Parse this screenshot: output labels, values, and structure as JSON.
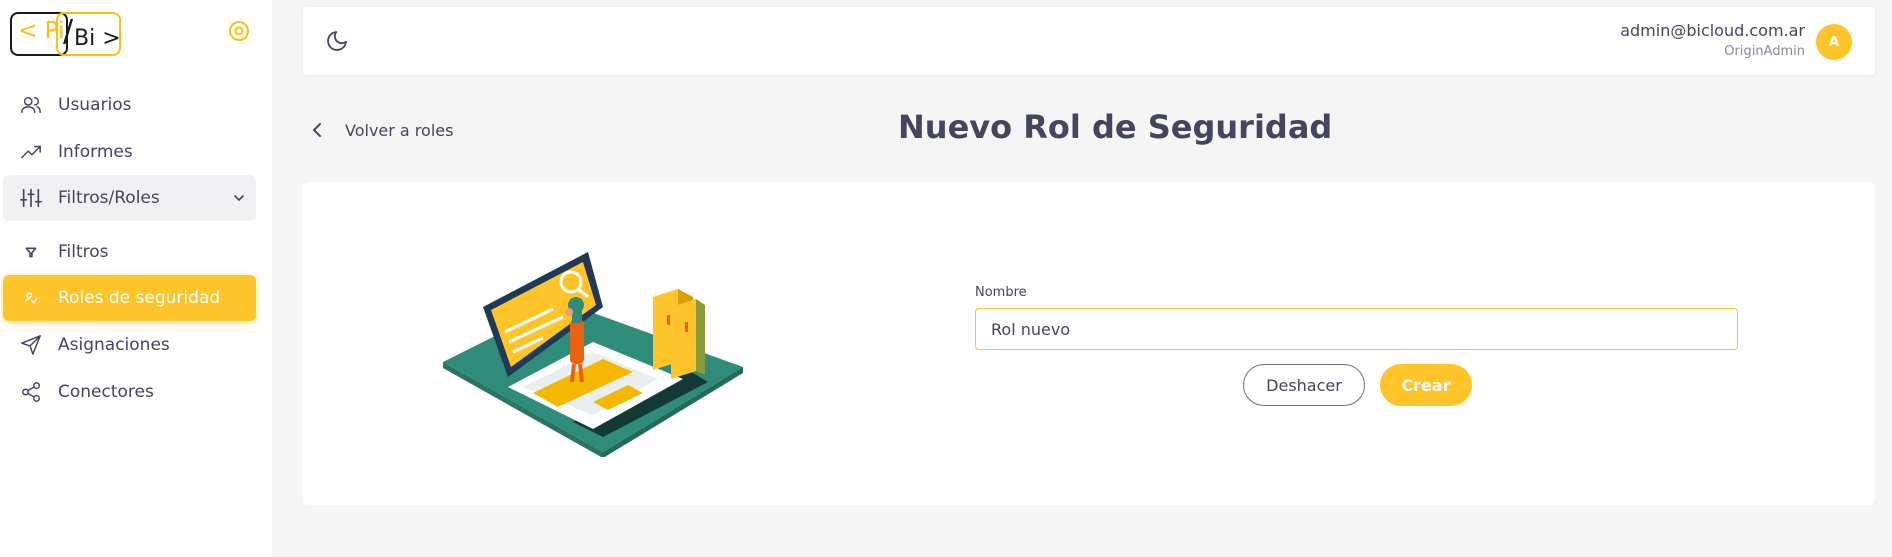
{
  "brand": {
    "logo_left": "< Pi",
    "logo_slash": "/",
    "logo_right": "Bi >"
  },
  "sidebar": {
    "items": [
      {
        "label": "Usuarios",
        "icon": "users-icon"
      },
      {
        "label": "Informes",
        "icon": "trending-up-icon"
      },
      {
        "label": "Filtros/Roles",
        "icon": "sliders-icon",
        "expanded": true
      },
      {
        "label": "Filtros",
        "icon": "filter-icon"
      },
      {
        "label": "Roles de seguridad",
        "icon": "user-check-icon",
        "active": true
      },
      {
        "label": "Asignaciones",
        "icon": "send-icon"
      },
      {
        "label": "Conectores",
        "icon": "share-icon"
      }
    ]
  },
  "header": {
    "email": "admin@bicloud.com.ar",
    "role": "OriginAdmin",
    "avatar_initial": "A"
  },
  "breadcrumb": {
    "back_label": "Volver a roles"
  },
  "page": {
    "title": "Nuevo Rol de Seguridad"
  },
  "form": {
    "name_label": "Nombre",
    "name_value": "Rol nuevo",
    "undo_label": "Deshacer",
    "create_label": "Crear"
  },
  "colors": {
    "accent": "#ffc42a",
    "text": "#454560",
    "teal": "#2f8c7a"
  }
}
